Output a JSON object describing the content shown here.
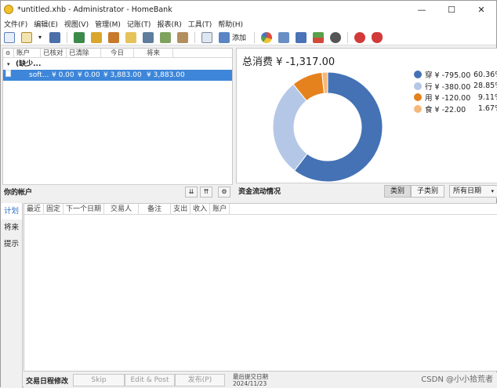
{
  "window": {
    "title": "*untitled.xhb - Administrator - HomeBank",
    "controls": {
      "minimize": "—",
      "maximize": "☐",
      "close": "✕"
    }
  },
  "menu": [
    "文件(F)",
    "编辑(E)",
    "视图(V)",
    "管理(M)",
    "记账(T)",
    "报表(R)",
    "工具(T)",
    "帮助(H)"
  ],
  "toolbar": {
    "add_label": "添加"
  },
  "accounts": {
    "columns": [
      "账户",
      "已核对",
      "已清除",
      "今日",
      "将来"
    ],
    "group_label": "(缺少...",
    "row": {
      "name": "soft...",
      "reconciled": "¥ 0.00",
      "cleared": "¥ 0.00",
      "today": "¥ 3,883.00",
      "future": "¥ 3,883.00"
    },
    "footer_title": "你的帐户"
  },
  "chart": {
    "title": "总消费 ¥ -1,317.00",
    "footer_title": "资金流动情况",
    "tab_category": "类别",
    "tab_subcategory": "子类别",
    "date_range": "所有日期",
    "legend": [
      {
        "label": "穿 ¥ -795.00",
        "pct": "60.36%",
        "color": "#4472b4"
      },
      {
        "label": "行 ¥ -380.00",
        "pct": "28.85%",
        "color": "#b4c7e7"
      },
      {
        "label": "用 ¥ -120.00",
        "pct": "9.11%",
        "color": "#e5821e"
      },
      {
        "label": "食 ¥ -22.00",
        "pct": "1.67%",
        "color": "#f4b97a"
      }
    ]
  },
  "chart_data": {
    "type": "pie",
    "title": "总消费 ¥ -1,317.00",
    "categories": [
      "穿",
      "行",
      "用",
      "食"
    ],
    "values": [
      -795.0,
      -380.0,
      -120.0,
      -22.0
    ],
    "percentages": [
      60.36,
      28.85,
      9.11,
      1.67
    ],
    "colors": [
      "#4472b4",
      "#b4c7e7",
      "#e5821e",
      "#f4b97a"
    ],
    "legend": "right"
  },
  "side_tabs": [
    "计划",
    "将来",
    "提示"
  ],
  "schedule": {
    "columns": [
      "最近",
      "固定",
      "下一个日期",
      "交易人",
      "备注",
      "支出",
      "收入",
      "账户"
    ],
    "footer_title": "交易日程修改",
    "skip_label": "Skip",
    "edit_post_label": "Edit & Post",
    "post_label": "发布(P)",
    "last_tx_label": "最后提交日期",
    "last_tx_date": "2024/11/23"
  },
  "watermark": "CSDN @小小拾荒者"
}
